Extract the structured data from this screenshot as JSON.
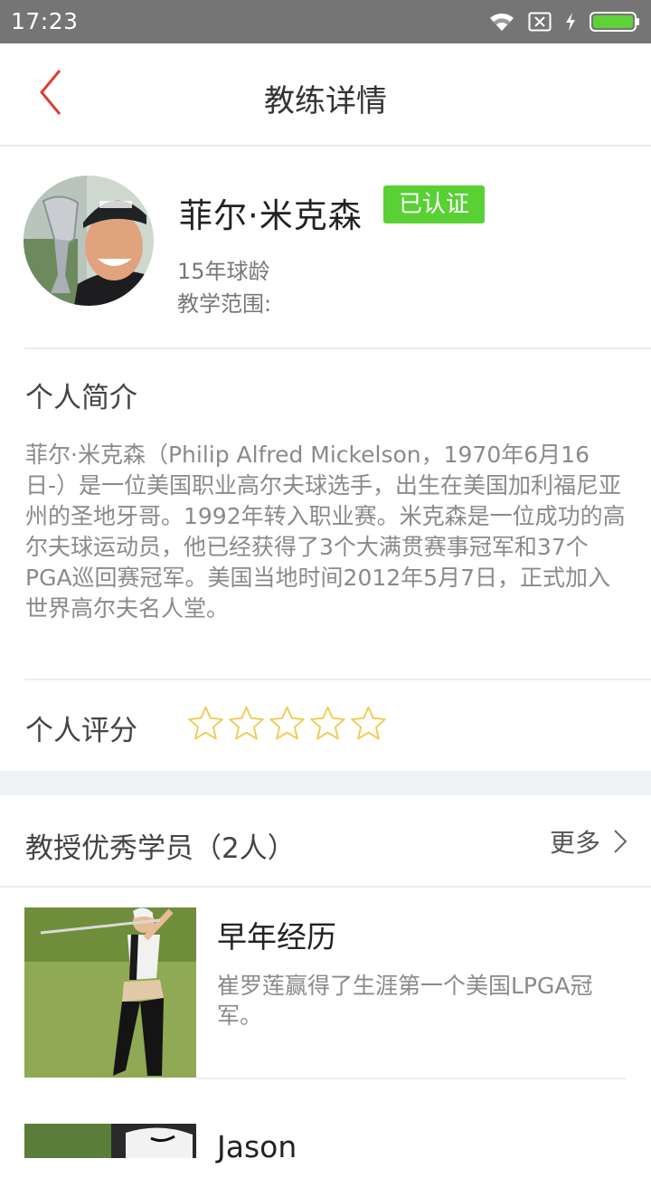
{
  "status_bar": {
    "time": "17:23"
  },
  "nav": {
    "title": "教练详情"
  },
  "profile": {
    "name": "菲尔·米克森",
    "badge": "已认证",
    "years": "15年球龄",
    "scope_label": "教学范围:"
  },
  "intro": {
    "title": "个人简介",
    "text": "菲尔·米克森（Philip Alfred Mickelson，1970年6月16日-）是一位美国职业高尔夫球选手，出生在美国加利福尼亚州的圣地牙哥。1992年转入职业赛。米克森是一位成功的高尔夫球运动员，他已经获得了3个大满贯赛事冠军和37个PGA巡回赛冠军。美国当地时间2012年5月7日，正式加入世界高尔夫名人堂。"
  },
  "rating": {
    "label": "个人评分",
    "stars_filled": 0,
    "stars_total": 5
  },
  "students": {
    "title": "教授优秀学员（2人）",
    "more_label": "更多",
    "items": [
      {
        "title": "早年经历",
        "desc": "崔罗莲赢得了生涯第一个美国LPGA冠军。"
      },
      {
        "title": "Jason",
        "desc": ""
      }
    ]
  },
  "colors": {
    "accent_red": "#e03c31",
    "badge_green": "#59d134",
    "star_yellow": "#f2c94c",
    "status_bar_bg": "#757575"
  }
}
